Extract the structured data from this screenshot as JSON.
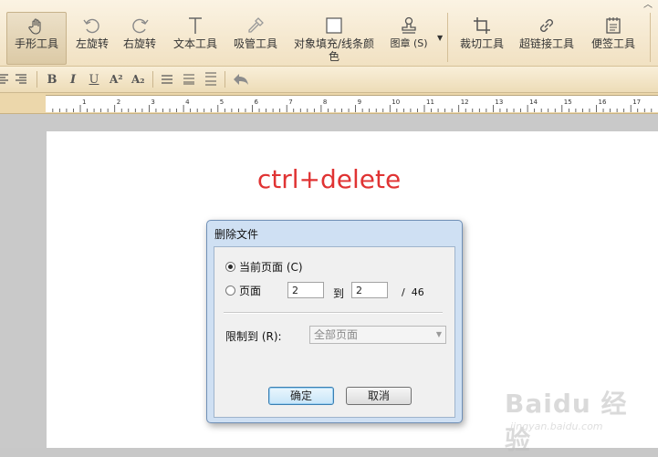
{
  "toolbar": {
    "tools": [
      {
        "label": "手形工具",
        "icon": "hand-icon",
        "active": true
      },
      {
        "label": "左旋转",
        "icon": "rotate-left-icon"
      },
      {
        "label": "右旋转",
        "icon": "rotate-right-icon"
      },
      {
        "label": "文本工具",
        "icon": "text-cursor-icon"
      },
      {
        "label": "吸管工具",
        "icon": "eyedropper-icon"
      },
      {
        "label": "对象填充/线条颜色",
        "icon": "fill-color-icon"
      },
      {
        "label": "图章 (S)",
        "icon": "stamp-icon"
      },
      {
        "label": "裁切工具",
        "icon": "crop-icon"
      },
      {
        "label": "超链接工具",
        "icon": "link-icon"
      },
      {
        "label": "便签工具",
        "icon": "note-icon"
      }
    ]
  },
  "formatbar": {
    "bold": "B",
    "italic": "I",
    "underline": "U",
    "superscript": "A²",
    "subscript": "A₂"
  },
  "ruler": {
    "labels": [
      "1",
      "2",
      "3",
      "4",
      "5",
      "6",
      "7",
      "8",
      "9",
      "10",
      "11",
      "12",
      "13",
      "14",
      "15",
      "16",
      "17"
    ]
  },
  "hint_text": "ctrl+delete",
  "dialog": {
    "title": "删除文件",
    "option_current": "当前页面 (C)",
    "option_pages": "页面",
    "from_page": "2",
    "to_label": "到",
    "to_page": "2",
    "total_label": "/  46",
    "limit_label": "限制到 (R):",
    "limit_value": "全部页面",
    "ok_label": "确定",
    "cancel_label": "取消"
  },
  "watermark": {
    "brand": "Baidu 经验",
    "url": "jingyan.baidu.com"
  },
  "colors": {
    "hint": "#e03333",
    "ribbon": "#f1e1c2",
    "dialog_frame": "#cfe0f3"
  }
}
